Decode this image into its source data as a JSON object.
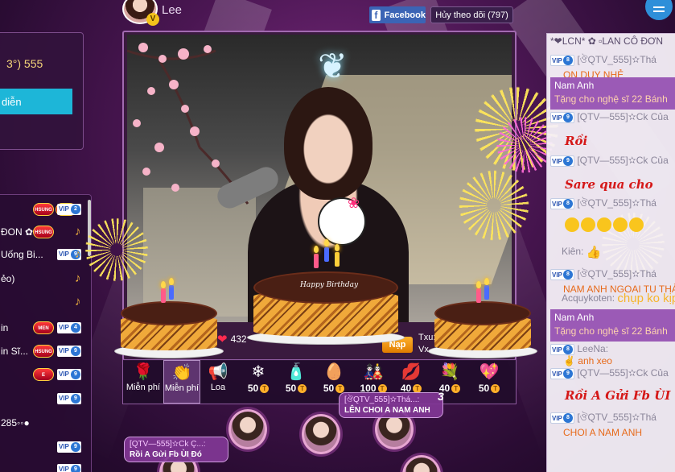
{
  "header": {
    "streamer_name": "Lee",
    "avatar_badge": "V",
    "facebook_label": "Facebook",
    "facebook_logo": "f",
    "follow_label": "Hủy theo dõi (797)"
  },
  "left_panel": {
    "score_text": "3°)  555",
    "show_button": "diễn",
    "users": [
      {
        "name": "",
        "badges": [
          "HSUNG",
          "DIAL"
        ],
        "vip": "2",
        "note": false
      },
      {
        "name": "ĐON ✿",
        "badges": [
          "HSUNG"
        ],
        "vip": "",
        "note": true
      },
      {
        "name": "Uống Bi...",
        "badges": [],
        "vip": "9",
        "note": true
      },
      {
        "name": "ẻo)",
        "badges": [],
        "vip": "",
        "note": true
      },
      {
        "name": "",
        "badges": [],
        "vip": "",
        "note": true
      },
      {
        "name": "in",
        "badges": [
          "MEN"
        ],
        "vip": "4",
        "note": false
      },
      {
        "name": "in Sĩ...",
        "badges": [
          "HSUNG"
        ],
        "vip": "9",
        "note": false
      },
      {
        "name": "",
        "badges": [
          "E"
        ],
        "vip": "9",
        "note": false
      },
      {
        "name": "",
        "badges": [],
        "vip": "9",
        "note": false
      },
      {
        "name": "285◦◦●",
        "badges": [],
        "vip": "",
        "note": false
      },
      {
        "name": "",
        "badges": [],
        "vip": "9",
        "note": false
      },
      {
        "name": "",
        "badges": [],
        "vip": "9",
        "note": false
      }
    ]
  },
  "stage": {
    "cake_text": "Happy Birthday",
    "hearts": "432",
    "nap_label": "Nạp",
    "txu_label": "Txu:",
    "vx_label": "Vx"
  },
  "gifts": [
    {
      "icon": "rose-icon",
      "glyph": "🌹",
      "label": "Miễn phí",
      "price": "",
      "selected": false
    },
    {
      "icon": "hand-icon",
      "glyph": "👏",
      "label": "Miễn phí",
      "price": "",
      "selected": true
    },
    {
      "icon": "megaphone-icon",
      "glyph": "📢",
      "label": "Loa",
      "price": "",
      "selected": false
    },
    {
      "icon": "snowflake-icon",
      "glyph": "❄",
      "label": "",
      "price": "50",
      "selected": false
    },
    {
      "icon": "bottle-icon",
      "glyph": "🧴",
      "label": "",
      "price": "50",
      "selected": false
    },
    {
      "icon": "egg-icon",
      "glyph": "🥚",
      "label": "",
      "price": "50",
      "selected": false
    },
    {
      "icon": "doll-icon",
      "glyph": "🎎",
      "label": "",
      "price": "100",
      "selected": false
    },
    {
      "icon": "lips-icon",
      "glyph": "💋",
      "label": "",
      "price": "40",
      "selected": false
    },
    {
      "icon": "bouquet-icon",
      "glyph": "💐",
      "label": "",
      "price": "40",
      "selected": false
    },
    {
      "icon": "heart-icon",
      "glyph": "💖",
      "label": "",
      "price": "50",
      "selected": false
    }
  ],
  "coin_glyph": "T",
  "bubbles": [
    {
      "user": "[QTV—555]✫Ck Ç...:",
      "message": "Rồi A Gửi Fb ÙI Đó"
    },
    {
      "user": "[ঔQTV_555]✫Thá...:",
      "message": "LÊN CHOI A NAM ANH",
      "count": "3"
    }
  ],
  "chat": [
    {
      "kind": "header",
      "text": "*❤LCN* ✿ ▫LAN CÔ ĐƠN"
    },
    {
      "kind": "line",
      "vip": "8",
      "user": "[ঔQTV_555]✫Thá",
      "text": "ON DUY NHẺ"
    },
    {
      "kind": "gift",
      "user": "Nam Anh",
      "text": "Tặng cho nghệ sĩ 22 Bánh"
    },
    {
      "kind": "line",
      "vip": "9",
      "user": "[QTV—555]✫Ck Của",
      "text": ""
    },
    {
      "kind": "big",
      "text": "Rồi"
    },
    {
      "kind": "line",
      "vip": "9",
      "user": "[QTV—555]✫Ck Của",
      "text": ""
    },
    {
      "kind": "big",
      "text": "Sare qua cho"
    },
    {
      "kind": "line",
      "vip": "8",
      "user": "[ঔQTV_555]✫Thá",
      "text": ""
    },
    {
      "kind": "emoji",
      "count": 5
    },
    {
      "kind": "plain",
      "user": "Kiên:",
      "text": "👍"
    },
    {
      "kind": "line",
      "vip": "8",
      "user": "[ঔQTV_555]✫Thá",
      "text": "NAM ANH NGOAI TU THẢ"
    },
    {
      "kind": "plain",
      "user": "Acquykoten:",
      "text": "chụp ko kịp"
    },
    {
      "kind": "gift",
      "user": "Nam Anh",
      "text": "Tặng cho nghệ sĩ 22 Bánh"
    },
    {
      "kind": "line",
      "vip": "8",
      "user": "LeeNa:",
      "text": "✌ anh xeo"
    },
    {
      "kind": "line",
      "vip": "9",
      "user": "[QTV—555]✫Ck Của",
      "text": ""
    },
    {
      "kind": "big",
      "text": "Rồi A Gửi Fb ÙI"
    },
    {
      "kind": "line",
      "vip": "8",
      "user": "[ঔQTV_555]✫Thá",
      "text": "CHOI A NAM ANH"
    }
  ]
}
